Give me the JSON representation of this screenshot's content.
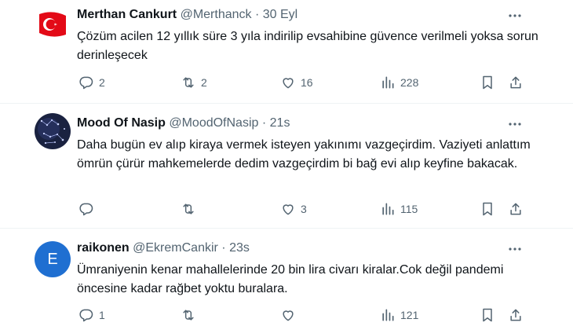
{
  "tweets": [
    {
      "name": "Merthan Cankurt",
      "handle": "@Merthanck",
      "sep": "·",
      "time": "30 Eyl",
      "text": "Çözüm acilen 12 yıllık süre 3 yıla indirilip evsahibine güvence verilmeli yoksa sorun derinleşecek",
      "replies": "2",
      "retweets": "2",
      "likes": "16",
      "views": "228",
      "avatar": "turkish-flag"
    },
    {
      "name": "Mood Of Nasip",
      "handle": "@MoodOfNasip",
      "sep": "·",
      "time": "21s",
      "text": "Daha bugün ev alıp kiraya vermek isteyen yakınımı vazgeçirdim. Vaziyeti anlattım ömrün çürür mahkemelerde dedim vazgeçirdim bi bağ evi alıp keyfine bakacak.",
      "replies": "",
      "retweets": "",
      "likes": "3",
      "views": "115",
      "avatar": "constellations"
    },
    {
      "name": "raikonen",
      "handle": "@EkremCankir",
      "sep": "·",
      "time": "23s",
      "text": "Ümraniyenin kenar mahallelerinde 20 bin lira civarı kiralar.Cok değil pandemi öncesine kadar rağbet yoktu buralara.",
      "replies": "1",
      "retweets": "",
      "likes": "",
      "views": "121",
      "avatar_letter": "E",
      "avatar_color": "#1f6fd1"
    }
  ]
}
